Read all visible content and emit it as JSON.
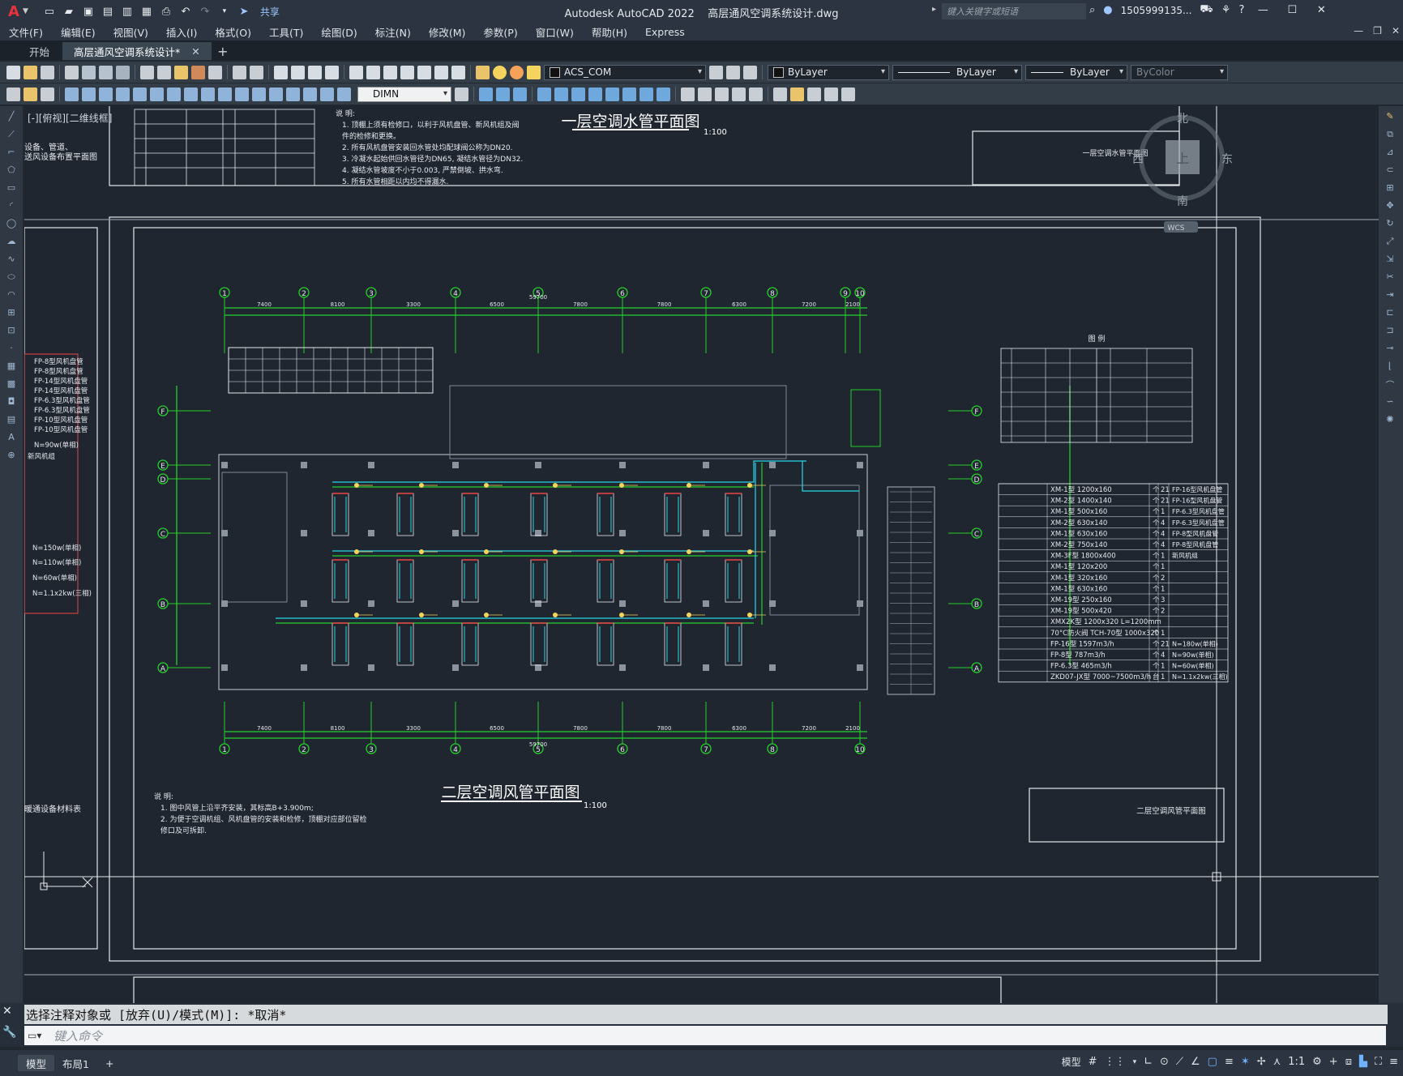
{
  "app": {
    "title": "Autodesk AutoCAD 2022",
    "document": "高层通风空调系统设计.dwg",
    "share": "共享",
    "search_placeholder": "键入关键字或短语",
    "user": "1505999135...",
    "accent": "#e8333a"
  },
  "menu": [
    "文件(F)",
    "编辑(E)",
    "视图(V)",
    "插入(I)",
    "格式(O)",
    "工具(T)",
    "绘图(D)",
    "标注(N)",
    "修改(M)",
    "参数(P)",
    "窗口(W)",
    "帮助(H)",
    "Express"
  ],
  "tabs": [
    {
      "label": "开始",
      "active": false
    },
    {
      "label": "高层通风空调系统设计*",
      "active": true
    }
  ],
  "toolbar": {
    "layer": "ACS_COM",
    "color": "ByLayer",
    "linetype": "ByLayer",
    "lineweight": "ByLayer",
    "plotstyle": "ByColor",
    "dimstyle": "DIMN"
  },
  "viewport": {
    "label": "[-][俯视][二维线框]",
    "viewcube": {
      "north": "北",
      "south": "南",
      "east": "东",
      "west": "西",
      "face": "上",
      "wcs": "WCS"
    }
  },
  "drawing": {
    "title_water": "一层空调水管平面图",
    "scale_water": "1:100",
    "title_air": "二层空调风管平面图",
    "scale_air": "1:100",
    "titleblock_water": "一层空调水管平面图",
    "titleblock_air": "二层空调风管平面图",
    "left_notes": [
      "设备、管道、",
      "送风设备布置平面图"
    ],
    "left_table_title": "暖通设备材料表",
    "notes_water": [
      "说 明:",
      "1. 顶棚上须有检修口，以利于风机盘管、新风机组及阀",
      "   件的检修和更换。",
      "2. 所有风机盘管安装回水管处均配球阀公称为DN20.",
      "3. 冷凝水起始供回水管径为DN65, 凝结水管径为DN32.",
      "4. 凝结水管坡度不小于0.003, 严禁倒坡、拱水弯.",
      "5. 所有水管相距以内均不得漏水."
    ],
    "notes_air": [
      "说 明:",
      "1. 图中风管上沿平齐安装，其标高B+3.900m;",
      "2. 为便于空调机组、风机盘管的安装和检修，顶棚对应部位留检",
      "   修口及可拆卸."
    ],
    "axis_labels_top": [
      "1",
      "2",
      "3",
      "4",
      "5",
      "6",
      "7",
      "8",
      "9",
      "10"
    ],
    "axis_labels_bottom": [
      "1",
      "2",
      "3",
      "4",
      "5",
      "6",
      "7",
      "8",
      "10"
    ],
    "axis_labels_side": [
      "F",
      "E",
      "D",
      "C",
      "B",
      "A"
    ],
    "dims_top": [
      "7400",
      "8100",
      "3300",
      "6500",
      "7800",
      "7800",
      "6300",
      "7200",
      "2100"
    ],
    "dims_total": "59700",
    "legend_title": "图 例",
    "right_table": [
      [
        "XM-1型 1200x160",
        "个",
        "21",
        "FP-16型风机盘管"
      ],
      [
        "XM-2型 1400x140",
        "个",
        "21",
        "FP-16型风机盘管"
      ],
      [
        "XM-1型 500x160",
        "个",
        "1",
        "FP-6.3型风机盘管"
      ],
      [
        "XM-2型 630x140",
        "个",
        "4",
        "FP-6.3型风机盘管"
      ],
      [
        "XM-1型 630x160",
        "个",
        "4",
        "FP-8型风机盘管"
      ],
      [
        "XM-2型 750x140",
        "个",
        "4",
        "FP-8型风机盘管"
      ],
      [
        "XM-3F型 1800x400",
        "个",
        "1",
        "新风机组"
      ],
      [
        "XM-1型 120x200",
        "个",
        "1",
        ""
      ],
      [
        "XM-1型 320x160",
        "个",
        "2",
        ""
      ],
      [
        "XM-1型 630x160",
        "个",
        "1",
        ""
      ],
      [
        "XM-19型 250x160",
        "个",
        "3",
        ""
      ],
      [
        "XM-19型 500x420",
        "个",
        "2",
        ""
      ],
      [
        "XMX2K型 1200x320 L=1200mm",
        "",
        "",
        ""
      ],
      [
        "70°C防火阀 TCH-70型 1000x320",
        "个",
        "1",
        ""
      ],
      [
        "FP-16型 1597m3/h",
        "个",
        "21",
        "N=180w(单相)"
      ],
      [
        "FP-8型 787m3/h",
        "个",
        "4",
        "N=90w(单相)"
      ],
      [
        "FP-6.3型 465m3/h",
        "个",
        "1",
        "N=60w(单相)"
      ],
      [
        "ZKD07-JX型 7000~7500m3/h",
        "台",
        "1",
        "N=1.1x2kw(三相)"
      ]
    ],
    "left_list": [
      "FP-8型风机盘管",
      "FP-8型风机盘管",
      "FP-14型风机盘管",
      "FP-14型风机盘管",
      "FP-6.3型风机盘管",
      "FP-6.3型风机盘管",
      "FP-10型风机盘管",
      "FP-10型风机盘管",
      "N=90w(单相)",
      "新风机组",
      "N=150w(单相)",
      "N=110w(单相)",
      "N=60w(单相)",
      "N=1.1x2kw(三相)"
    ]
  },
  "command": {
    "history": "选择注释对象或 [放弃(U)/模式(M)]: *取消*",
    "placeholder": "键入命令"
  },
  "status": {
    "tabs": [
      {
        "label": "模型",
        "active": true
      },
      {
        "label": "布局1",
        "active": false
      }
    ],
    "model": "模型",
    "scale": "1:1"
  }
}
